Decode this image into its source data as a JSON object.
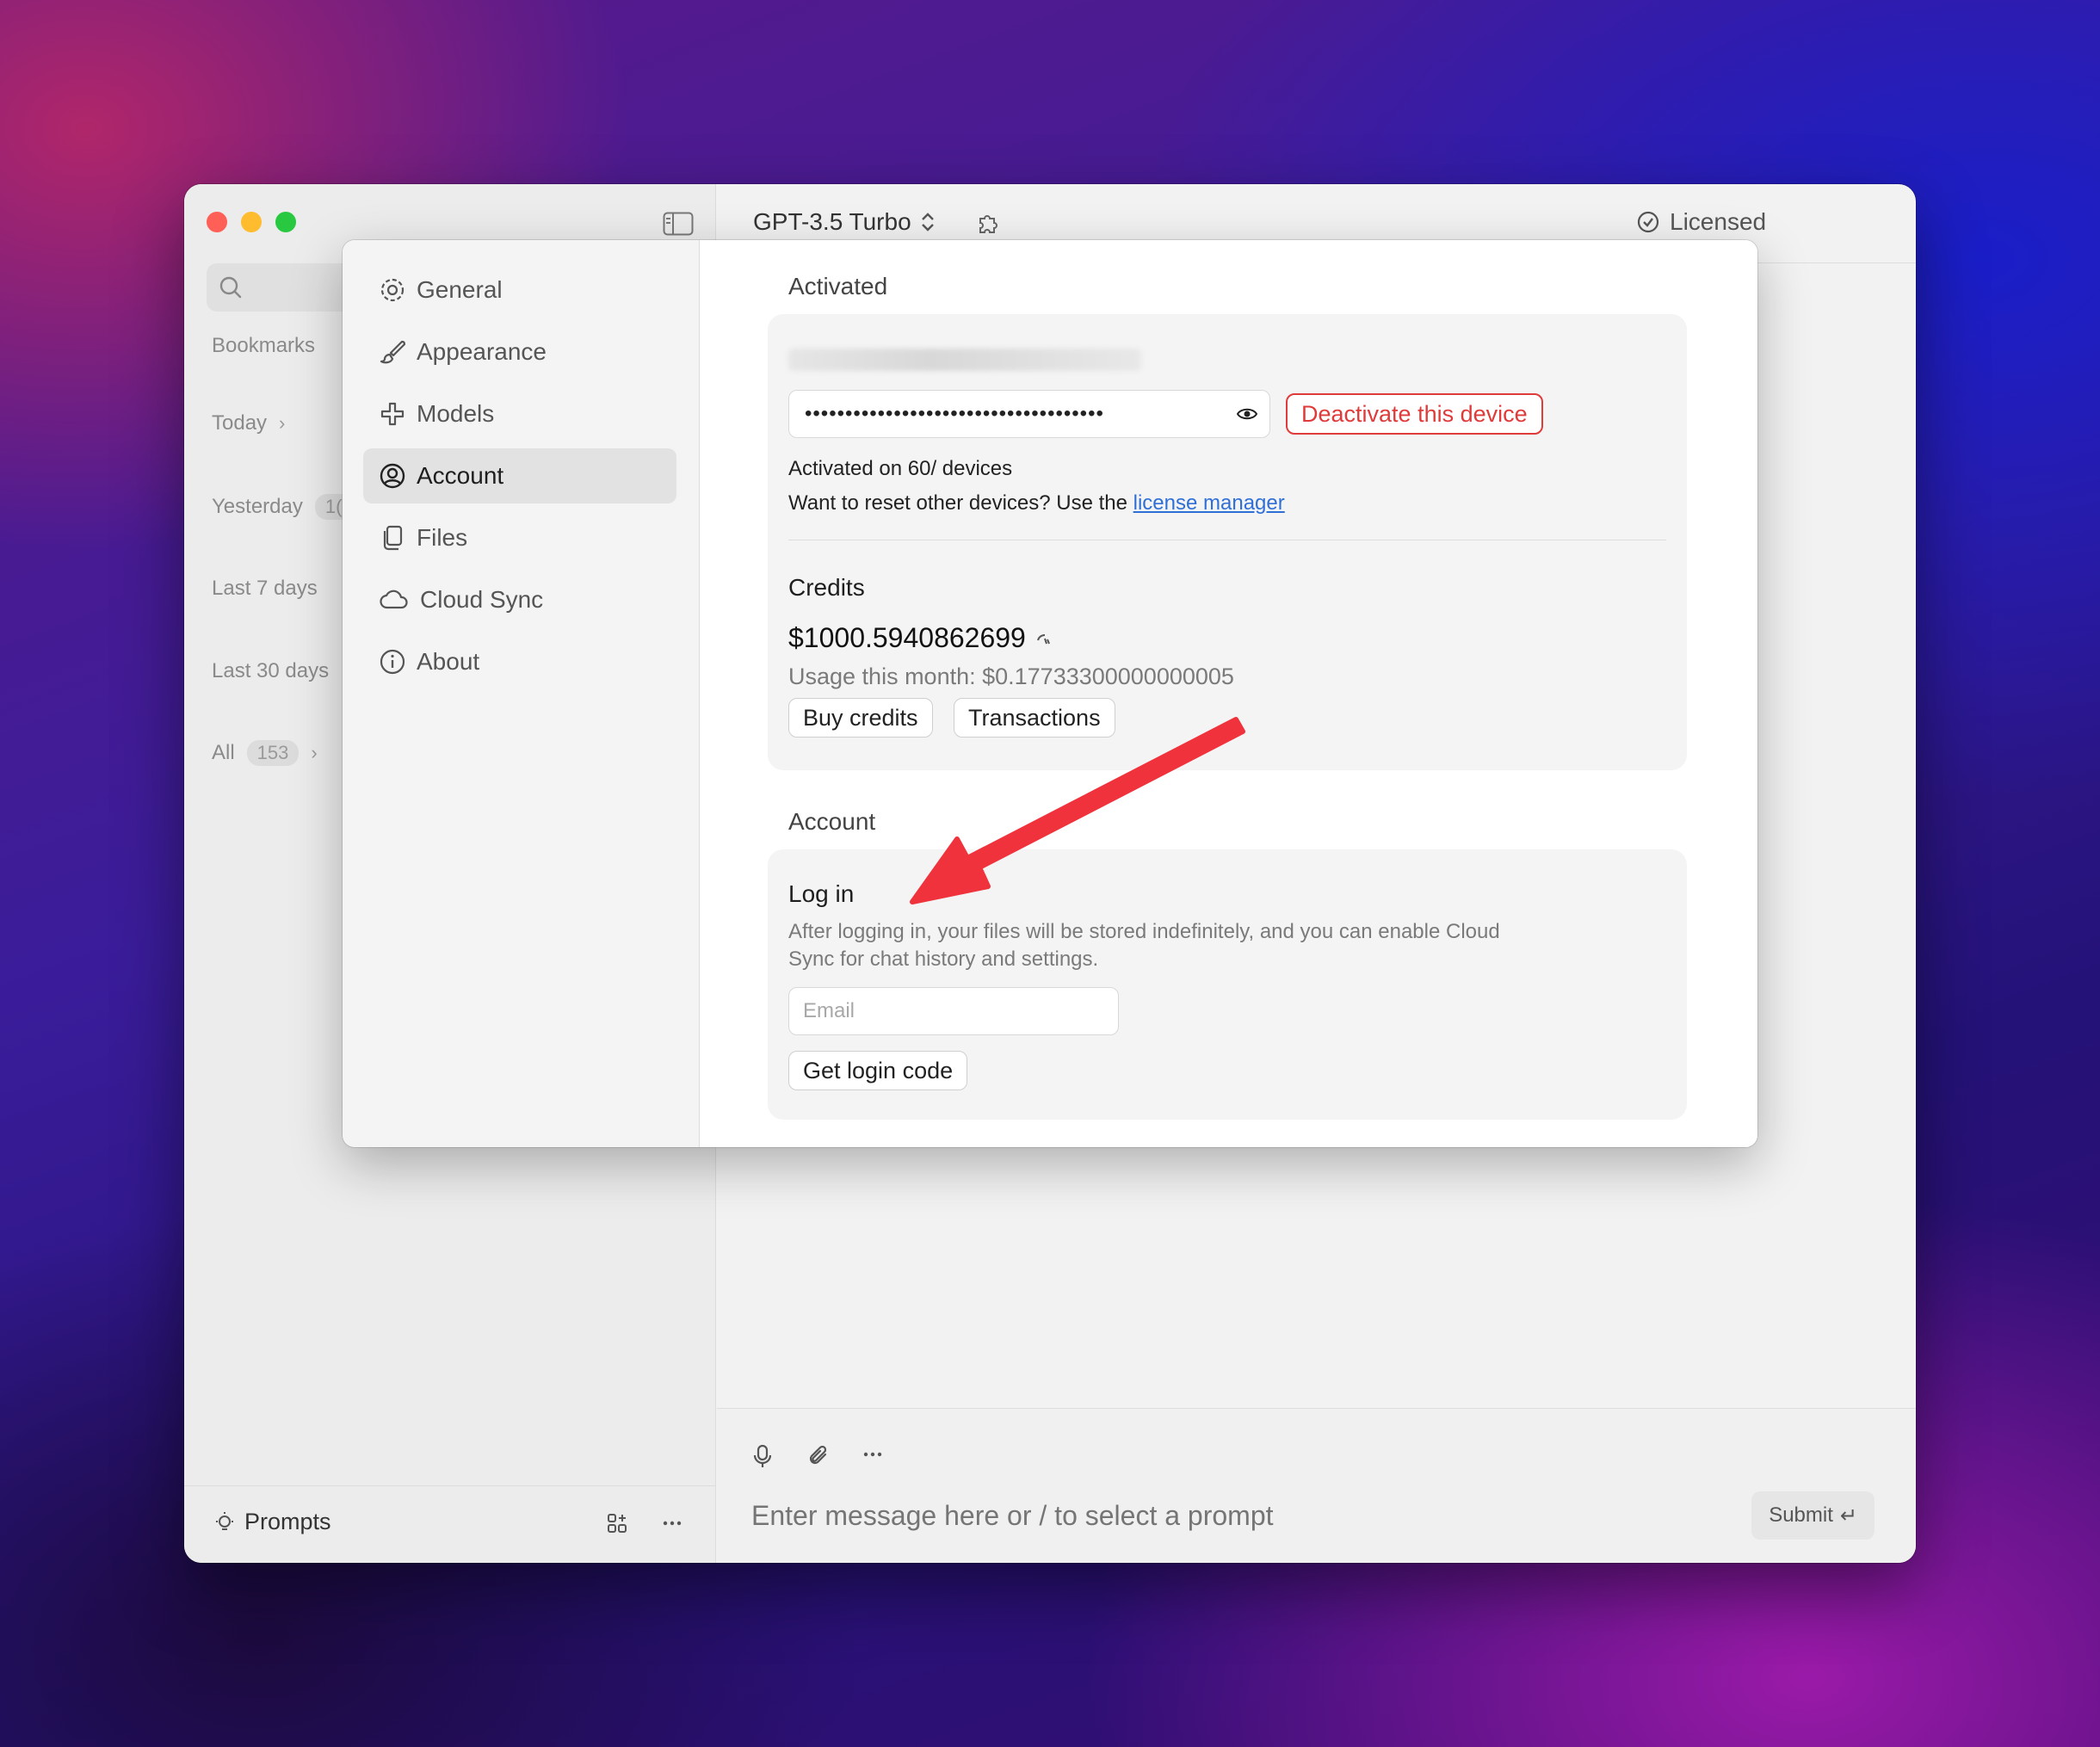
{
  "window": {
    "sidebar": {
      "labels": {
        "bookmarks": "Bookmarks",
        "today": "Today",
        "yesterday": "Yesterday",
        "yesterday_count": "1(",
        "last7": "Last 7 days",
        "last30": "Last 30 days",
        "all": "All",
        "all_count": "153"
      },
      "prompts_label": "Prompts"
    },
    "topbar": {
      "model": "GPT-3.5 Turbo",
      "licensed": "Licensed"
    },
    "composer": {
      "placeholder": "Enter message here or / to select a prompt",
      "submit": "Submit"
    }
  },
  "settings": {
    "nav": [
      {
        "label": "General",
        "icon": "gear-icon"
      },
      {
        "label": "Appearance",
        "icon": "brush-icon"
      },
      {
        "label": "Models",
        "icon": "models-icon"
      },
      {
        "label": "Account",
        "icon": "user-circle-icon",
        "active": true
      },
      {
        "label": "Files",
        "icon": "files-icon"
      },
      {
        "label": "Cloud Sync",
        "icon": "cloud-icon"
      },
      {
        "label": "About",
        "icon": "info-icon"
      }
    ],
    "activated": {
      "section_title": "Activated",
      "license_key_masked": "•••••••••••••••••••••••••••••••••••••",
      "deactivate_label": "Deactivate this device",
      "activated_on": "Activated on 60/ devices",
      "reset_text": "Want to reset other devices? Use the ",
      "license_manager_link": "license manager"
    },
    "credits": {
      "title": "Credits",
      "amount": "$1000.5940862699",
      "usage": "Usage this month: $0.17733300000000005",
      "buy_label": "Buy credits",
      "transactions_label": "Transactions"
    },
    "account": {
      "section_title": "Account",
      "login_title": "Log in",
      "login_desc_line1": "After logging in, your files will be stored indefinitely, and you can enable Cloud",
      "login_desc_line2": "Sync for chat history and settings.",
      "email_placeholder": "Email",
      "get_code_label": "Get login code"
    }
  },
  "colors": {
    "accent_red": "#e03b3b",
    "link_blue": "#2f6fd6",
    "annotation_arrow": "#f0323c"
  }
}
